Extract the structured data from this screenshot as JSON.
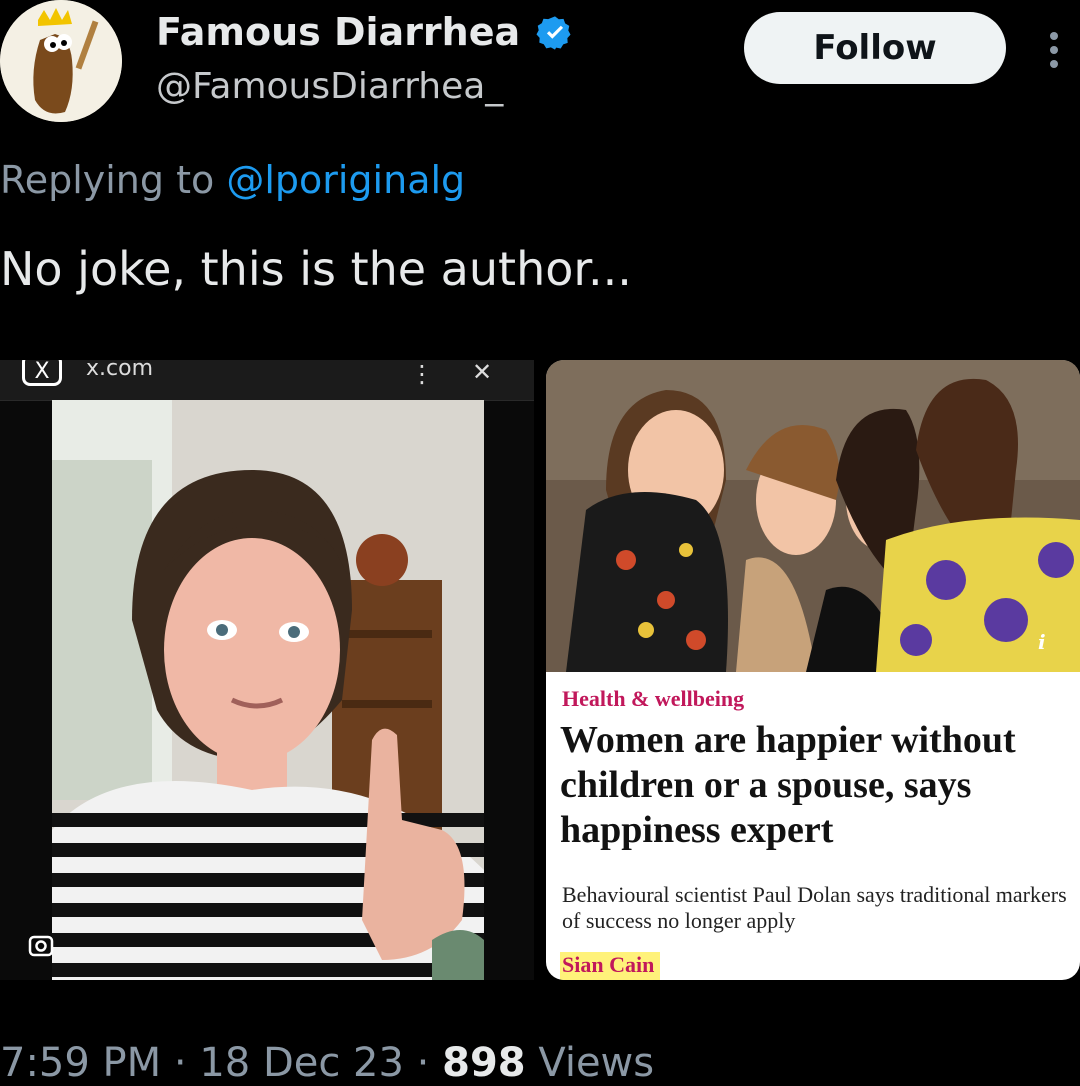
{
  "author": {
    "display_name": "Famous Diarrhea",
    "handle": "@FamousDiarrhea_",
    "verified": true,
    "verified_color": "#1d9bf0"
  },
  "actions": {
    "follow_label": "Follow"
  },
  "reply": {
    "prefix": "Replying to",
    "mention": "@lporiginalg"
  },
  "tweet": {
    "text": "No joke, this is the author..."
  },
  "media_left": {
    "url_text": "x.com",
    "logo_text": "X"
  },
  "media_right": {
    "kicker": "Health & wellbeing",
    "headline": "Women are happier without children or a spouse, says happiness expert",
    "standfirst": "Behavioural scientist Paul Dolan says traditional markers of success no longer apply",
    "byline": "Sian Cain",
    "accent_color": "#c1185b",
    "info_glyph": "i"
  },
  "meta": {
    "time": "7:59 PM",
    "date": "18 Dec 23",
    "views_count": "898",
    "views_label": "Views"
  },
  "icons": [
    "verified-badge-icon",
    "more-options-icon",
    "x-logo-icon",
    "lens-icon",
    "info-icon"
  ]
}
